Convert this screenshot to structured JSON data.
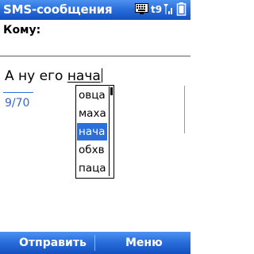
{
  "titlebar": {
    "title": "SMS-сообщения",
    "tray": {
      "input_mode_label": "t9",
      "keyboard_icon": "keyboard-icon",
      "signal_icon": "signal-icon",
      "battery_icon": "battery-icon"
    }
  },
  "recipient": {
    "label": "Кому:",
    "value": ""
  },
  "message": {
    "text_prefix": "А ну его ",
    "current_word": "нача",
    "counter": "9/70"
  },
  "suggestions": {
    "items": [
      "овца",
      "маха",
      "нача",
      "обхв",
      "паца"
    ],
    "selected_index": 2
  },
  "softkeys": {
    "left": "Отправить",
    "right": "Меню"
  },
  "colors": {
    "bar_blue": "#2a6fdc",
    "selection_blue": "#2a6fdc",
    "counter_blue": "#3a66c8"
  }
}
